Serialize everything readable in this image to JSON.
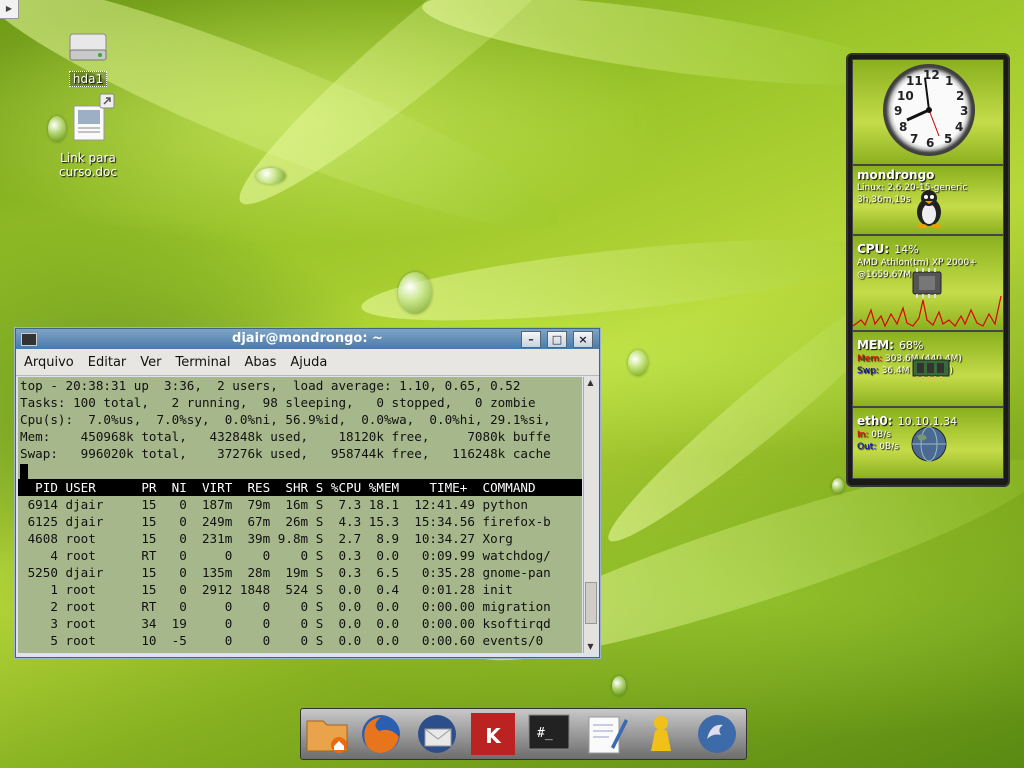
{
  "desktop": {
    "icons": [
      {
        "label": "hda1"
      },
      {
        "label": "Link para curso.doc"
      }
    ]
  },
  "terminal": {
    "title": "djair@mondrongo: ~",
    "menu": [
      "Arquivo",
      "Editar",
      "Ver",
      "Terminal",
      "Abas",
      "Ajuda"
    ],
    "lines": [
      "top - 20:38:31 up  3:36,  2 users,  load average: 1.10, 0.65, 0.52",
      "Tasks: 100 total,   2 running,  98 sleeping,   0 stopped,   0 zombie",
      "Cpu(s):  7.0%us,  7.0%sy,  0.0%ni, 56.9%id,  0.0%wa,  0.0%hi, 29.1%si,",
      "Mem:    450968k total,   432848k used,    18120k free,     7080k buffe",
      "Swap:   996020k total,    37276k used,   958744k free,   116248k cache"
    ],
    "header": "  PID USER      PR  NI  VIRT  RES  SHR S %CPU %MEM    TIME+  COMMAND     ",
    "processes": [
      " 6914 djair     15   0  187m  79m  16m S  7.3 18.1  12:41.49 python",
      " 6125 djair     15   0  249m  67m  26m S  4.3 15.3  15:34.56 firefox-b",
      " 4608 root      15   0  231m  39m 9.8m S  2.7  8.9  10:34.27 Xorg",
      "    4 root      RT   0     0    0    0 S  0.3  0.0   0:09.99 watchdog/",
      " 5250 djair     15   0  135m  28m  19m S  0.3  6.5   0:35.28 gnome-pan",
      "    1 root      15   0  2912 1848  524 S  0.0  0.4   0:01.28 init",
      "    2 root      RT   0     0    0    0 S  0.0  0.0   0:00.00 migration",
      "    3 root      34  19     0    0    0 S  0.0  0.0   0:00.00 ksoftirqd",
      "    5 root      10  -5     0    0    0 S  0.0  0.0   0:00.60 events/0"
    ]
  },
  "gadgets": {
    "clock": {
      "numbers": [
        "12",
        "1",
        "2",
        "3",
        "4",
        "5",
        "6",
        "7",
        "8",
        "9",
        "10",
        "11"
      ]
    },
    "system": {
      "hostname": "mondrongo",
      "kernel": "Linux: 2.6.20-15-generic",
      "uptime": "3h,36m,19s"
    },
    "cpu": {
      "label": "CPU:",
      "value": "14%",
      "model": "AMD Athlon(tm) XP 2000+",
      "freq": "@1659.67M"
    },
    "mem": {
      "label": "MEM:",
      "value": "68%",
      "mem_key": "Mem:",
      "mem_val": "303.6M (440.4M)",
      "swp_key": "Swp:",
      "swp_val": "36.4M (972.7M)"
    },
    "net": {
      "label": "eth0:",
      "ip": "10.10.1.34",
      "in_key": "In:",
      "in_val": "0B/s",
      "out_key": "Out:",
      "out_val": "0B/s"
    }
  },
  "dock": {
    "icons": [
      "home-folder-icon",
      "firefox-icon",
      "thunderbird-icon",
      "k3b-icon",
      "terminal-icon",
      "text-editor-icon",
      "user-icon",
      "network-icon"
    ]
  }
}
